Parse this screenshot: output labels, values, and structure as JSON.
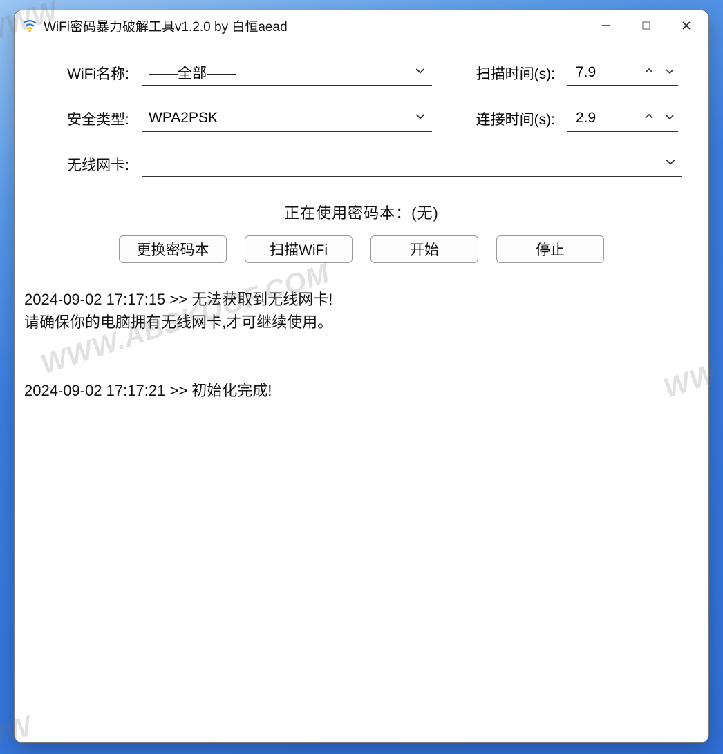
{
  "window": {
    "title": "WiFi密码暴力破解工具v1.2.0 by 白恒aead"
  },
  "form": {
    "wifi_name_label": "WiFi名称:",
    "wifi_name_value": "——全部——",
    "security_label": "安全类型:",
    "security_value": "WPA2PSK",
    "adapter_label": "无线网卡:",
    "adapter_value": "",
    "scan_time_label": "扫描时间(s):",
    "scan_time_value": "7.9",
    "connect_time_label": "连接时间(s):",
    "connect_time_value": "2.9"
  },
  "status": {
    "password_book": "正在使用密码本：(无)"
  },
  "buttons": {
    "change_book": "更换密码本",
    "scan": "扫描WiFi",
    "start": "开始",
    "stop": "停止"
  },
  "log": "2024-09-02 17:17:15 >> 无法获取到无线网卡!\n请确保你的电脑拥有无线网卡,才可继续使用。\n\n\n2024-09-02 17:17:21 >> 初始化完成!",
  "watermarks": [
    "WWW.ABSKOOF.COM",
    "WWW",
    "WW",
    "WW"
  ]
}
